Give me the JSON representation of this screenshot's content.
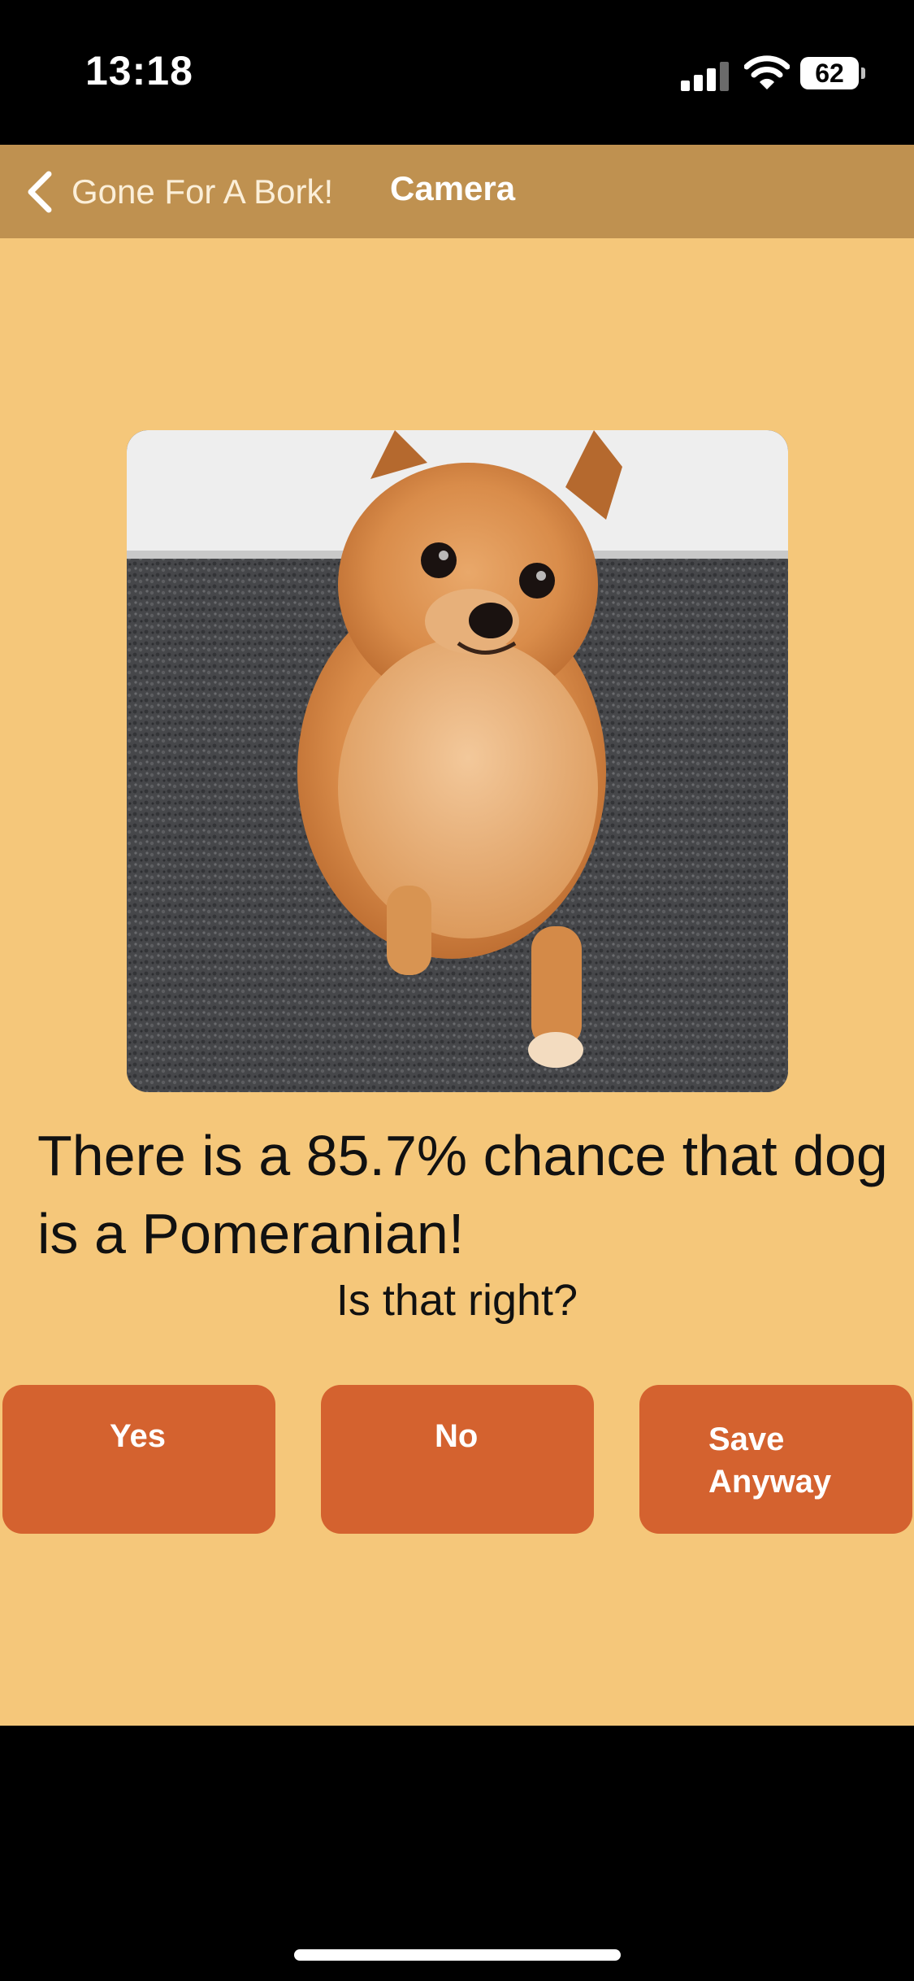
{
  "status_bar": {
    "time": "13:18",
    "battery": "62",
    "icons": [
      "signal-icon",
      "wifi-icon",
      "battery-icon"
    ]
  },
  "nav": {
    "back_label": "Gone For A Bork!",
    "title": "Camera",
    "back_icon": "chevron-left-icon"
  },
  "photo": {
    "subject": "pomeranian-dog-photo"
  },
  "result": {
    "text": "There is a 85.7% chance that dog is a Pomeranian!",
    "prompt": "Is that right?"
  },
  "actions": {
    "yes": "Yes",
    "no": "No",
    "save": "Save Anyway"
  },
  "colors": {
    "background": "#f5c77a",
    "nav_bar": "#bf9150",
    "button": "#d4622f",
    "button_text": "#ffffff"
  }
}
